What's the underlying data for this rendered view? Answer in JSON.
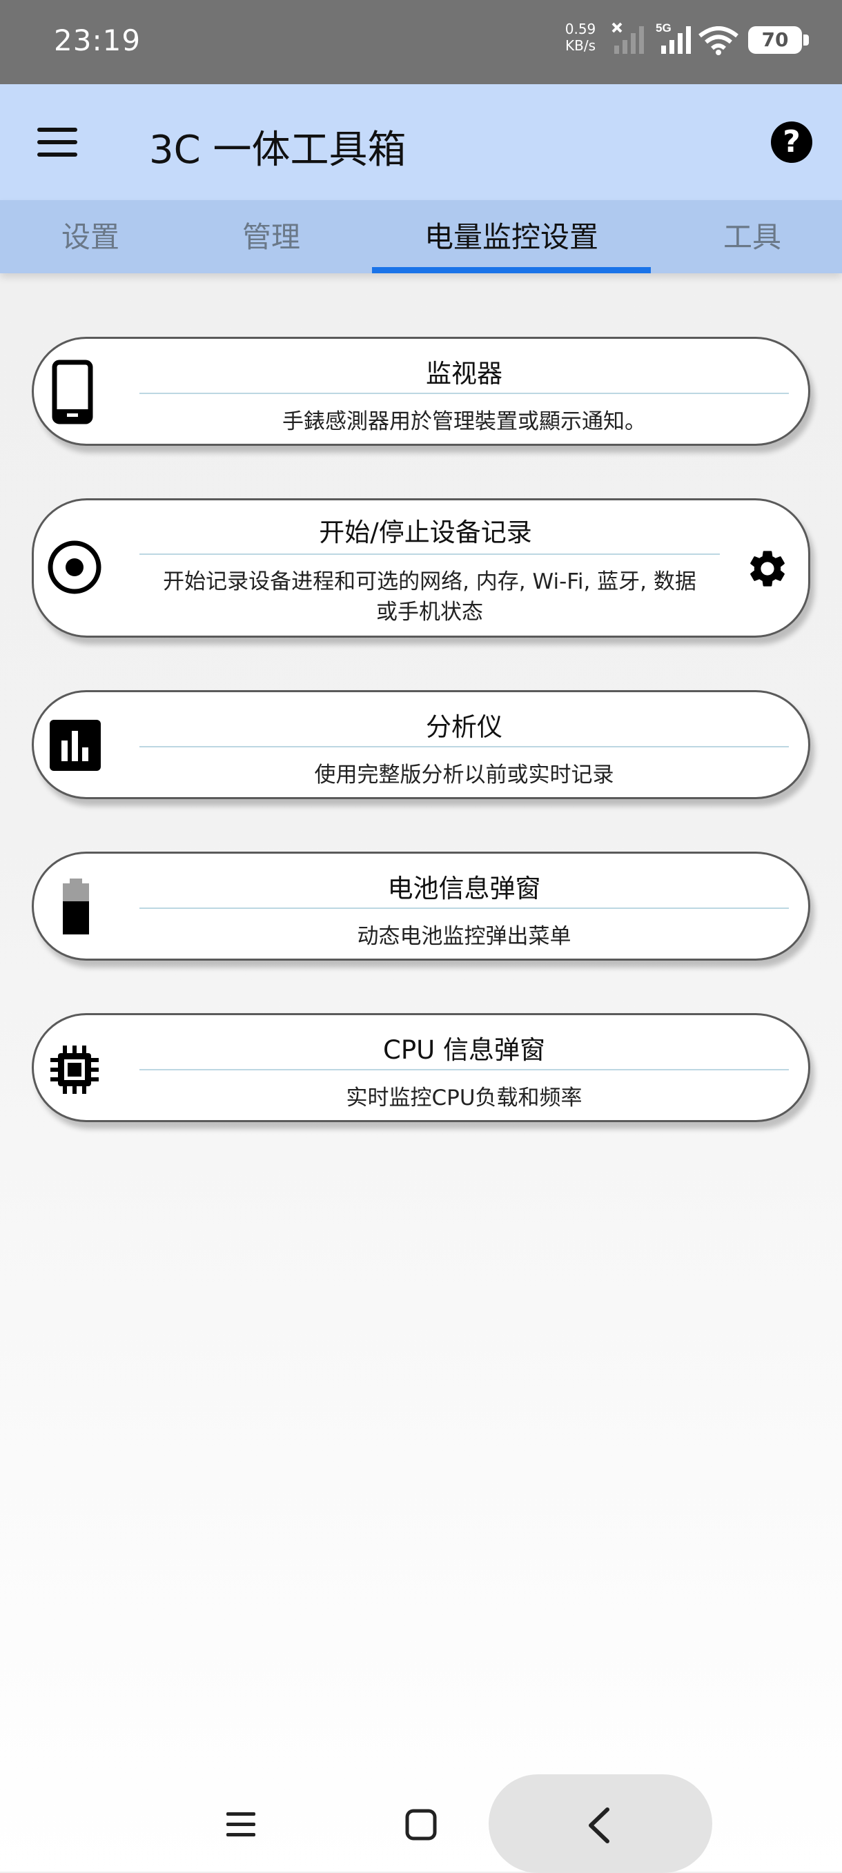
{
  "status_bar": {
    "time": "23:19",
    "net_speed_value": "0.59",
    "net_speed_unit": "KB/s",
    "network_type": "5G",
    "battery_level": "70"
  },
  "app_bar": {
    "title": "3C 一体工具箱",
    "help_glyph": "?"
  },
  "tabs": [
    {
      "label": "设置",
      "active": false
    },
    {
      "label": "管理",
      "active": false
    },
    {
      "label": "电量监控设置",
      "active": true
    },
    {
      "label": "工具",
      "active": false
    }
  ],
  "cards": [
    {
      "title": "监视器",
      "description": "手錶感測器用於管理裝置或顯示通知。",
      "icon": "phone-icon"
    },
    {
      "title": "开始/停止设备记录",
      "description_line1": "开始记录设备进程和可选的网络, 内存, Wi-Fi, 蓝牙, 数据",
      "description_line2": "或手机状态",
      "icon": "record-icon",
      "action_icon": "gear-icon"
    },
    {
      "title": "分析仪",
      "description": "使用完整版分析以前或实时记录",
      "icon": "bar-chart-icon"
    },
    {
      "title": "电池信息弹窗",
      "description": "动态电池监控弹出菜单",
      "icon": "battery-icon"
    },
    {
      "title": "CPU 信息弹窗",
      "description": "实时监控CPU负载和频率",
      "icon": "cpu-chip-icon"
    }
  ],
  "colors": {
    "status_bar": "#737373",
    "app_bar": "#c5dafa",
    "tab_bar": "#afc9ef",
    "tab_indicator": "#1a73e8"
  }
}
